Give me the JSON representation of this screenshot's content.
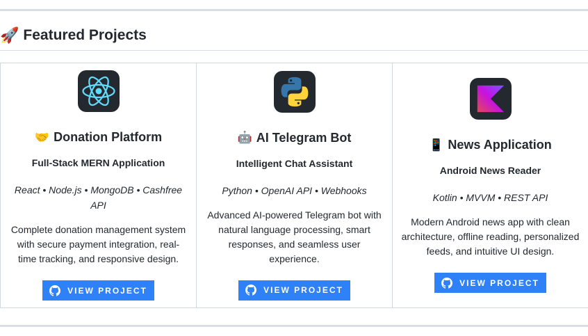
{
  "section": {
    "emoji": "🚀",
    "title": "Featured Projects"
  },
  "projects": [
    {
      "logo_icon": "react-icon",
      "emoji": "🤝",
      "title": "Donation Platform",
      "subtitle": "Full-Stack MERN Application",
      "tech": "React • Node.js • MongoDB • Cashfree API",
      "description": "Complete donation management system with secure payment integration, real-time tracking, and responsive design.",
      "button_label": "VIEW PROJECT"
    },
    {
      "logo_icon": "python-icon",
      "emoji": "🤖",
      "title": "AI Telegram Bot",
      "subtitle": "Intelligent Chat Assistant",
      "tech": "Python • OpenAI API • Webhooks",
      "description": "Advanced AI-powered Telegram bot with natural language processing, smart responses, and seamless user experience.",
      "button_label": "VIEW PROJECT"
    },
    {
      "logo_icon": "kotlin-icon",
      "emoji": "📱",
      "title": "News Application",
      "subtitle": "Android News Reader",
      "tech": "Kotlin • MVVM • REST API",
      "description": "Modern Android news app with clean architecture, offline reading, personalized feeds, and intuitive UI design.",
      "button_label": "VIEW PROJECT"
    }
  ],
  "colors": {
    "button": "#2f81f7",
    "logo_bg": "#24292f",
    "react": "#61dafb",
    "python_blue": "#3776ab",
    "python_yellow": "#ffd43b"
  }
}
